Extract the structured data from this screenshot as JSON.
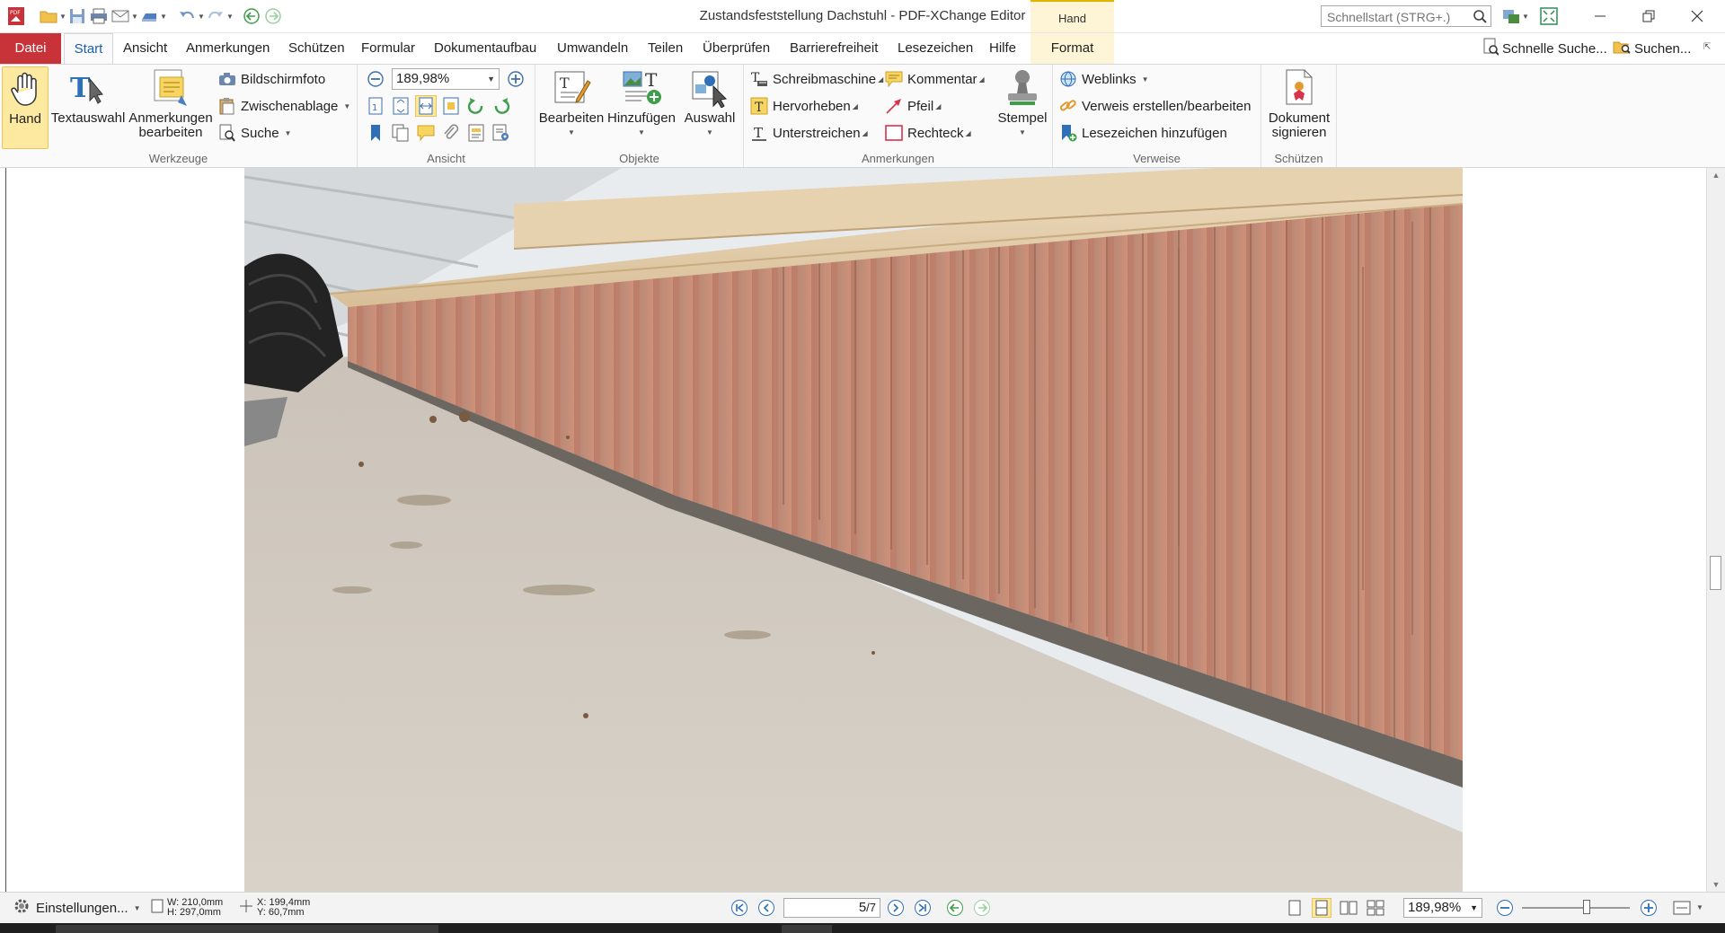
{
  "window": {
    "title": "Zustandsfeststellung Dachstuhl - PDF-XChange Editor",
    "context_tab_header": "Hand",
    "search_placeholder": "Schnellstart (STRG+.)"
  },
  "menu_tabs": [
    {
      "label": "Datei"
    },
    {
      "label": "Start"
    },
    {
      "label": "Ansicht"
    },
    {
      "label": "Anmerkungen"
    },
    {
      "label": "Schützen"
    },
    {
      "label": "Formular"
    },
    {
      "label": "Dokumentaufbau"
    },
    {
      "label": "Umwandeln"
    },
    {
      "label": "Teilen"
    },
    {
      "label": "Überprüfen"
    },
    {
      "label": "Barrierefreiheit"
    },
    {
      "label": "Lesezeichen"
    },
    {
      "label": "Hilfe"
    },
    {
      "label": "Format"
    }
  ],
  "quick_right": {
    "quick_search": "Schnelle Suche...",
    "search": "Suchen..."
  },
  "ribbon": {
    "werkzeuge": {
      "label": "Werkzeuge",
      "hand": "Hand",
      "textauswahl": "Textauswahl",
      "anmerkungen_1": "Anmerkungen",
      "anmerkungen_2": "bearbeiten",
      "bildschirmfoto": "Bildschirmfoto",
      "zwischenablage": "Zwischenablage",
      "suche": "Suche"
    },
    "ansicht": {
      "label": "Ansicht",
      "zoom": "189,98%"
    },
    "objekte": {
      "label": "Objekte",
      "bearbeiten": "Bearbeiten",
      "hinzufuegen": "Hinzufügen",
      "auswahl": "Auswahl"
    },
    "anmerkungen": {
      "label": "Anmerkungen",
      "schreibmaschine": "Schreibmaschine",
      "hervorheben": "Hervorheben",
      "unterstreichen": "Unterstreichen",
      "kommentar": "Kommentar",
      "pfeil": "Pfeil",
      "rechteck": "Rechteck",
      "stempel": "Stempel"
    },
    "verweise": {
      "label": "Verweise",
      "weblinks": "Weblinks",
      "verweis": "Verweis erstellen/bearbeiten",
      "lesezeichen": "Lesezeichen hinzufügen"
    },
    "schuetzen": {
      "label": "Schützen",
      "dokument": "Dokument",
      "signieren": "signieren"
    }
  },
  "statusbar": {
    "settings": "Einstellungen...",
    "width": "W: 210,0mm",
    "height": "H: 297,0mm",
    "x": "X: 199,4mm",
    "y": "Y:   60,7mm",
    "page_current": "5",
    "page_total": "/7",
    "zoom": "189,98%"
  },
  "colors": {
    "file_tab": "#c8333a",
    "context_highlight": "#fdf5d6",
    "active_tool": "#fde9a0",
    "link_blue": "#1a5fb4"
  }
}
